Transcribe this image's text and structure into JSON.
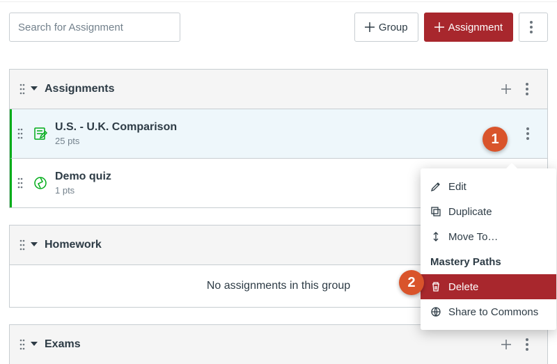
{
  "search": {
    "placeholder": "Search for Assignment"
  },
  "buttons": {
    "group": "Group",
    "assignment": "Assignment"
  },
  "groups": [
    {
      "title": "Assignments"
    },
    {
      "title": "Homework",
      "empty_text": "No assignments in this group"
    },
    {
      "title": "Exams"
    }
  ],
  "items": [
    {
      "title": "U.S. - U.K. Comparison",
      "sub": "25 pts"
    },
    {
      "title": "Demo quiz",
      "sub": "1 pts"
    }
  ],
  "menu": {
    "edit": "Edit",
    "duplicate": "Duplicate",
    "moveto": "Move To…",
    "mastery": "Mastery Paths",
    "delete": "Delete",
    "share": "Share to Commons"
  },
  "callouts": {
    "one": "1",
    "two": "2"
  }
}
